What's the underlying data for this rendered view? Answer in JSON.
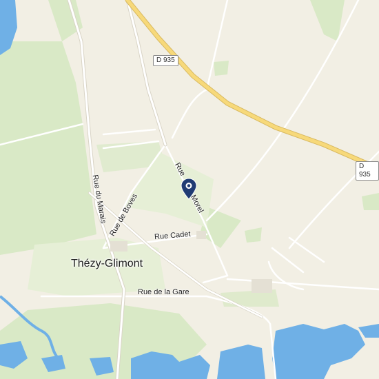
{
  "map": {
    "town": "Thézy-Glimont",
    "roads": {
      "rue_du_marais": "Rue du Marais",
      "rue_de_boves": "Rue de Boves",
      "rue_cadet": "Rue Cadet",
      "rue_de_la_gare": "Rue de la Gare",
      "rue_morel_left": "Rue",
      "rue_morel_right": "Morel"
    },
    "shields": {
      "d935_top": "D 935",
      "d935_right": "D 935"
    },
    "marker": {
      "icon": "location-pin-icon",
      "color": "#1f3b73"
    },
    "colors": {
      "land": "#f2efe4",
      "green": "#d7e8c3",
      "water": "#6fb0e6",
      "highway": "#f7d97a",
      "road": "#ffffff"
    }
  }
}
